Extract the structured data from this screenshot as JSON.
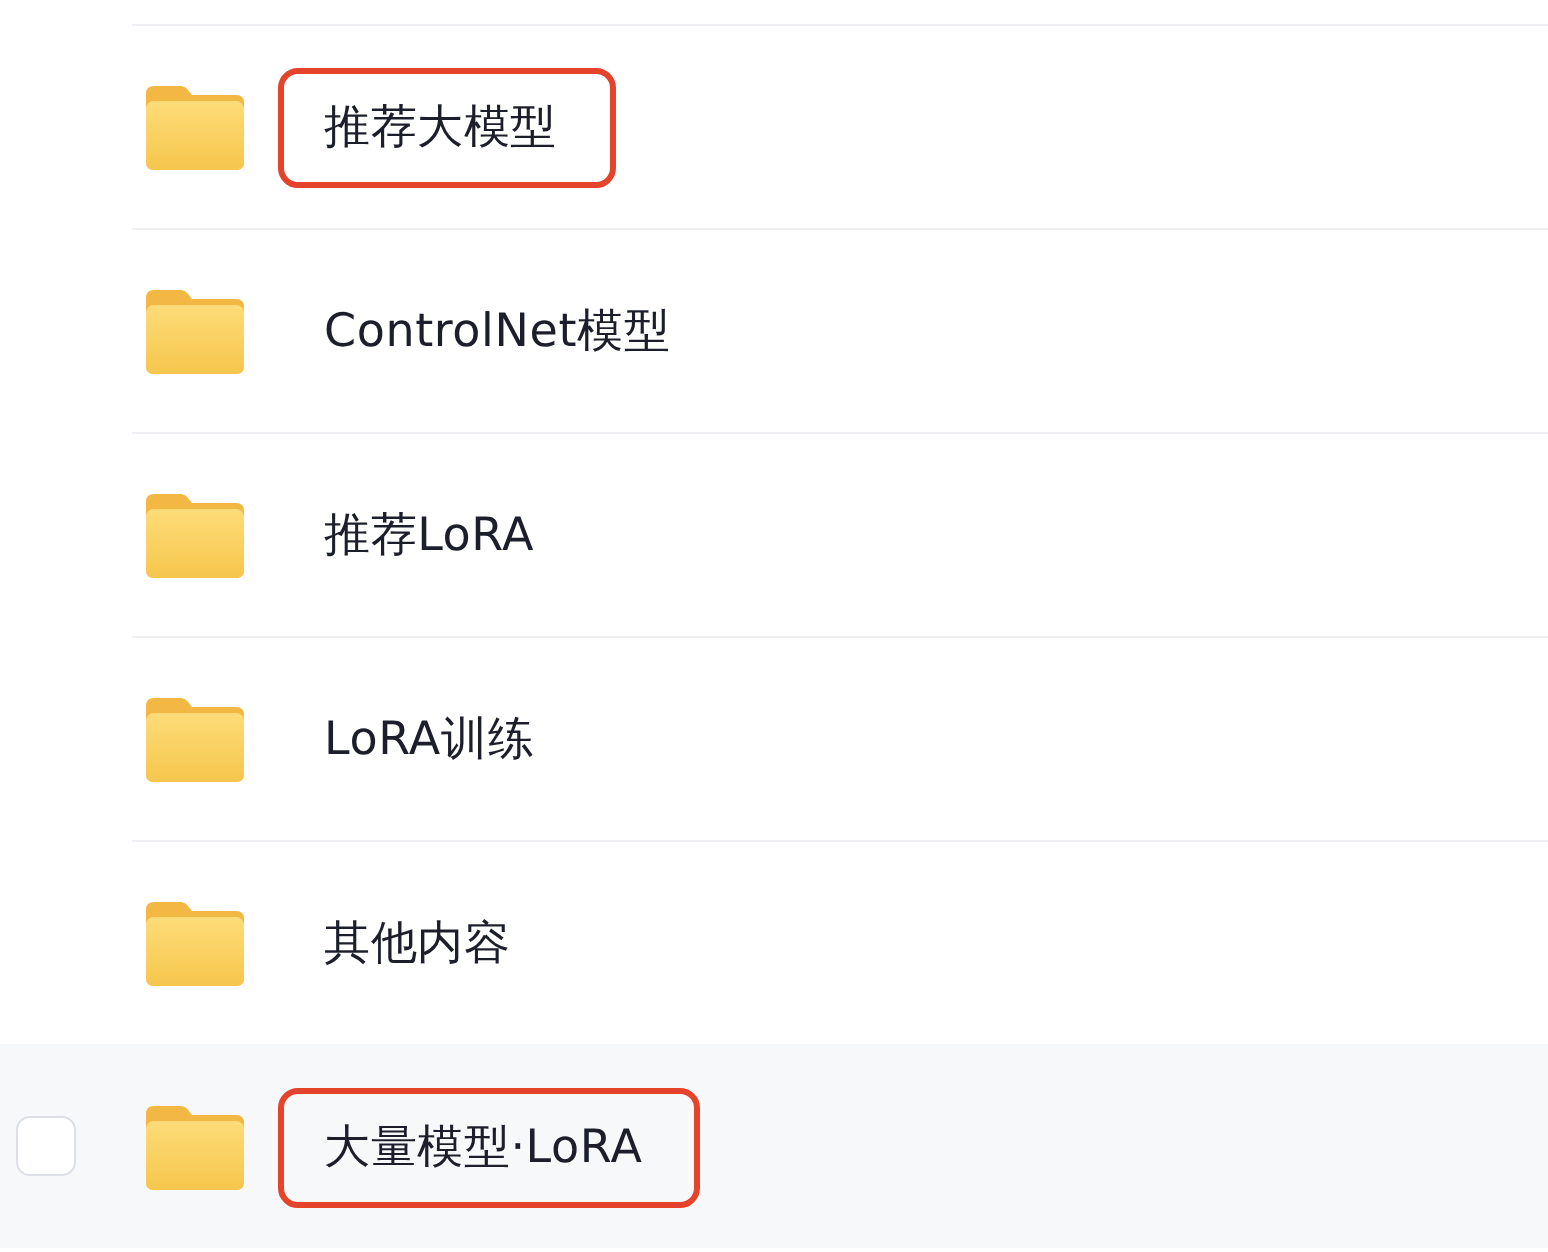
{
  "folders": [
    {
      "name": "推荐大模型",
      "annotated": true,
      "hovered": false,
      "checked": false
    },
    {
      "name": "ControlNet模型",
      "annotated": false,
      "hovered": false,
      "checked": false
    },
    {
      "name": "推荐LoRA",
      "annotated": false,
      "hovered": false,
      "checked": false
    },
    {
      "name": "LoRA训练",
      "annotated": false,
      "hovered": false,
      "checked": false
    },
    {
      "name": "其他内容",
      "annotated": false,
      "hovered": false,
      "checked": false
    },
    {
      "name": "大量模型·LoRA",
      "annotated": true,
      "hovered": true,
      "checked": false
    }
  ]
}
